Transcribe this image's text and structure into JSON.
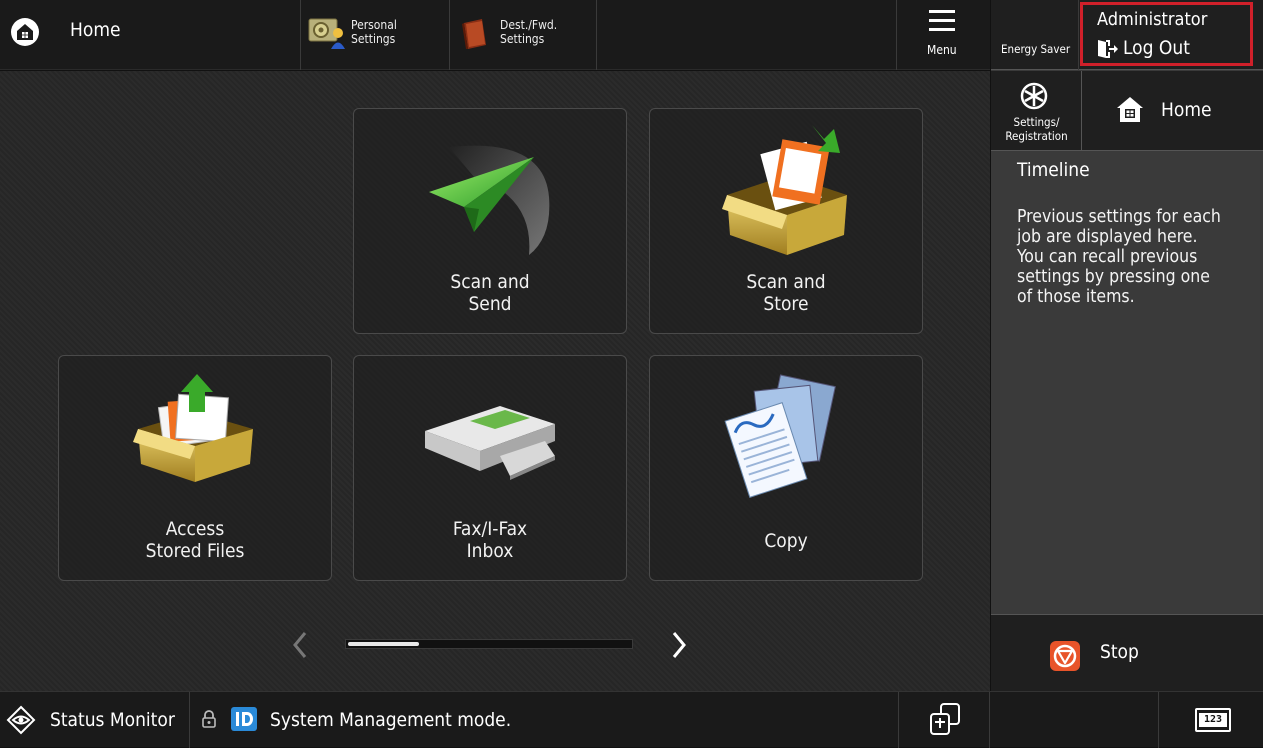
{
  "topbar": {
    "home_label": "Home",
    "personal_settings_label": "Personal\nSettings",
    "dest_settings_label": "Dest./Fwd.\nSettings",
    "menu_label": "Menu"
  },
  "right_panel": {
    "energy_saver_label": "Energy Saver",
    "user_name": "Administrator",
    "logout_label": "Log Out",
    "settings_registration_label": "Settings/\nRegistration",
    "home_label": "Home",
    "timeline_title": "Timeline",
    "timeline_text": "Previous settings for each\njob are displayed here.\nYou can recall previous\nsettings by pressing one\nof those items.",
    "stop_label": "Stop"
  },
  "tiles": [
    {
      "label": "Scan and\nSend",
      "icon": "paper-plane-icon"
    },
    {
      "label": "Scan and\nStore",
      "icon": "store-box-icon"
    },
    {
      "label": "Access\nStored Files",
      "icon": "stored-files-box-icon"
    },
    {
      "label": "Fax/I-Fax\nInbox",
      "icon": "fax-inbox-icon"
    },
    {
      "label": "Copy",
      "icon": "copy-documents-icon"
    }
  ],
  "pager": {
    "progress": 0.25
  },
  "bottombar": {
    "status_monitor_label": "Status Monitor",
    "mode_text": "System Management mode.",
    "keypad_label": "123"
  },
  "colors": {
    "highlight_red": "#d0202a",
    "stop_orange": "#e8542a",
    "id_blue": "#2a8ad8"
  }
}
